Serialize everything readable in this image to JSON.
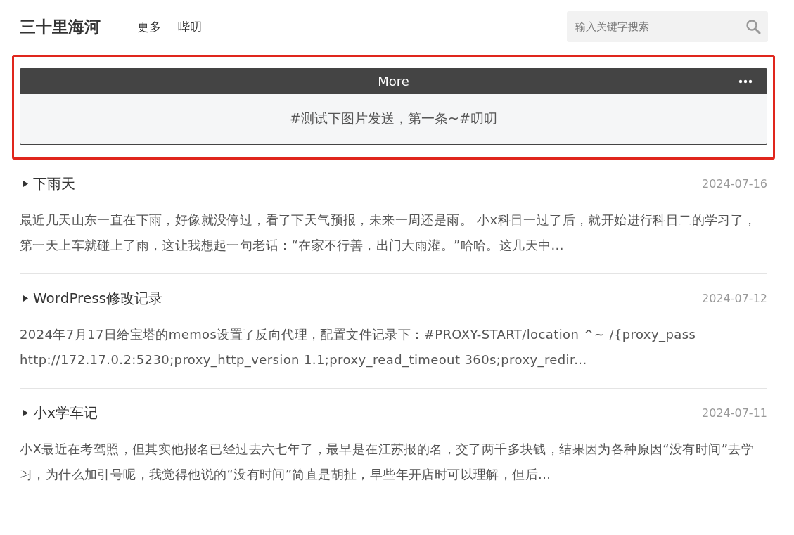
{
  "site": {
    "title": "三十里海河",
    "nav": [
      "更多",
      "哔叨"
    ],
    "search": {
      "placeholder": "输入关键字搜索"
    }
  },
  "memo_widget": {
    "title": "More",
    "highlighted": true,
    "content": "#测试下图片发送，第一条~#叨叨"
  },
  "posts": [
    {
      "title": "下雨天",
      "date": "2024-07-16",
      "excerpt": "最近几天山东一直在下雨，好像就没停过，看了下天气预报，未来一周还是雨。 小x科目一过了后，就开始进行科目二的学习了，第一天上车就碰上了雨，这让我想起一句老话：“在家不行善，出门大雨灌。”哈哈。这几天中..."
    },
    {
      "title": "WordPress修改记录",
      "date": "2024-07-12",
      "excerpt": "2024年7月17日给宝塔的memos设置了反向代理，配置文件记录下：#PROXY-START/location ^~ /{proxy_pass http://172.17.0.2:5230;proxy_http_version 1.1;proxy_read_timeout 360s;proxy_redir..."
    },
    {
      "title": "小x学车记",
      "date": "2024-07-11",
      "excerpt": "小X最近在考驾照，但其实他报名已经过去六七年了，最早是在江苏报的名，交了两千多块钱，结果因为各种原因“没有时间”去学习，为什么加引号呢，我觉得他说的“没有时间”简直是胡扯，早些年开店时可以理解，但后..."
    }
  ]
}
